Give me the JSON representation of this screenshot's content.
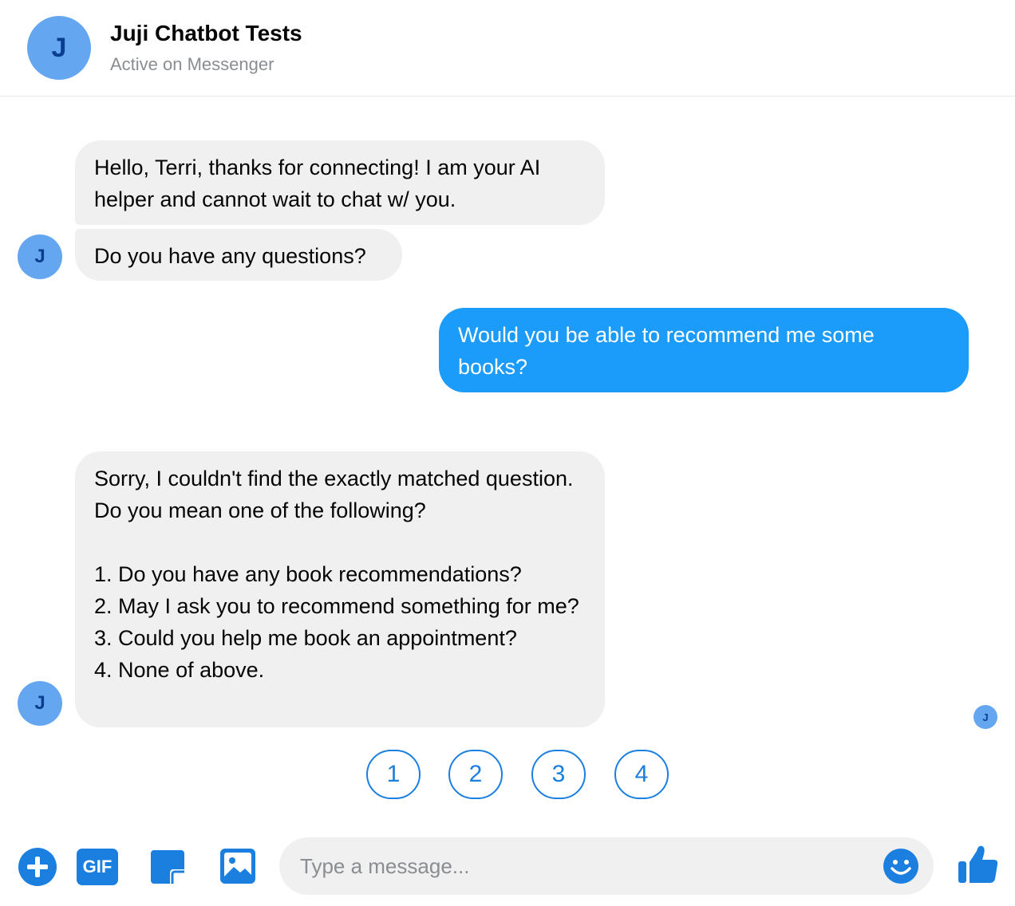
{
  "header": {
    "avatar_letter": "J",
    "title": "Juji Chatbot Tests",
    "status": "Active on Messenger"
  },
  "messages": [
    {
      "sender": "bot",
      "text": "Hello,  Terri, thanks for connecting! I am your AI helper and cannot wait to chat w/ you."
    },
    {
      "sender": "bot",
      "text": "Do you have any questions?"
    },
    {
      "sender": "user",
      "text": "Would you be able to recommend me some books?"
    },
    {
      "sender": "bot",
      "text": "Sorry, I couldn't find the exactly matched question. Do you mean one of the following?\n\n1. Do you have any book recommendations?\n2. May I ask you to recommend something for me?\n3. Could you help me book an appointment?\n4. None of above."
    }
  ],
  "bot_avatar_letter": "J",
  "quick_replies": [
    "1",
    "2",
    "3",
    "4"
  ],
  "composer": {
    "placeholder": "Type a message...",
    "gif_label": "GIF"
  },
  "colors": {
    "accent": "#1b7fe0",
    "user_bubble": "#1b9bfa",
    "bot_bubble": "#f0f0f0",
    "avatar": "#64a6f0"
  }
}
